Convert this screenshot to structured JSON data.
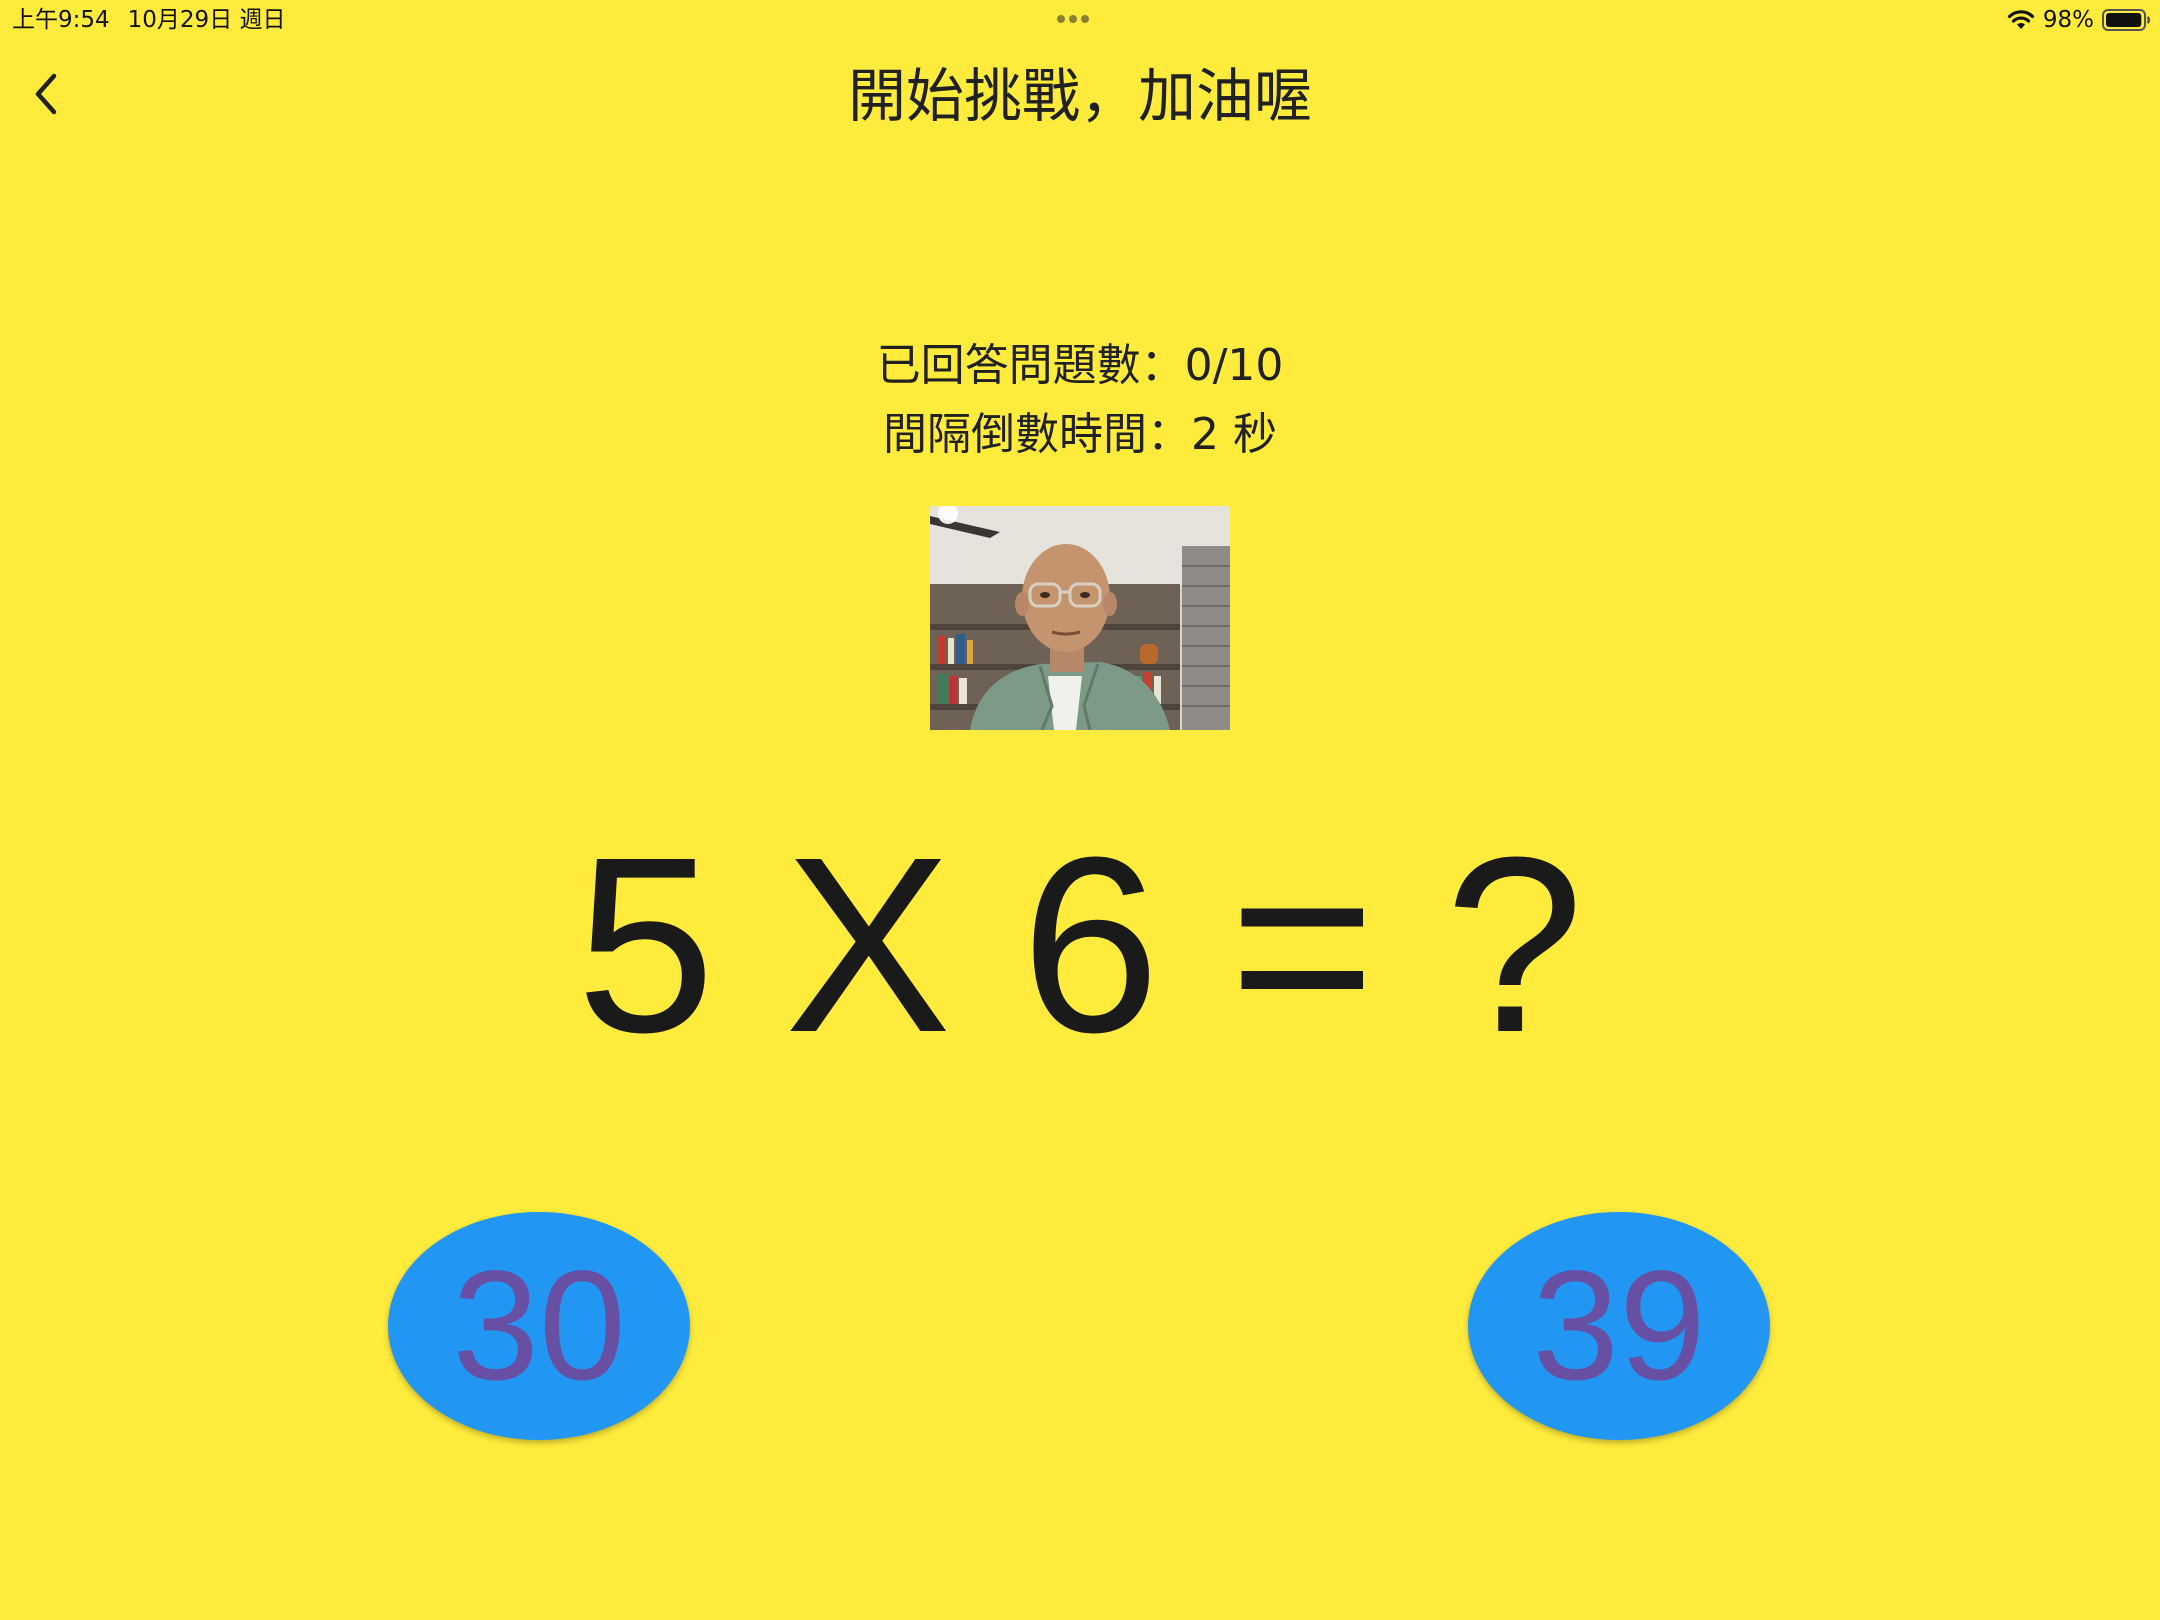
{
  "status_bar": {
    "time": "上午9:54",
    "date": "10月29日 週日",
    "battery": "98%",
    "battery_level": 0.98
  },
  "header": {
    "title": "開始挑戰，加油喔",
    "back_icon": "chevron-left-icon"
  },
  "info": {
    "answered": "已回答問題數：0/10",
    "countdown": "間隔倒數時間：2 秒"
  },
  "question": {
    "text": "5 X 6 = ?"
  },
  "answers": {
    "left": "30",
    "right": "39"
  },
  "colors": {
    "background": "#FFEB3B",
    "button": "#2196F3",
    "button_text": "#6750A4",
    "text": "#212121"
  }
}
